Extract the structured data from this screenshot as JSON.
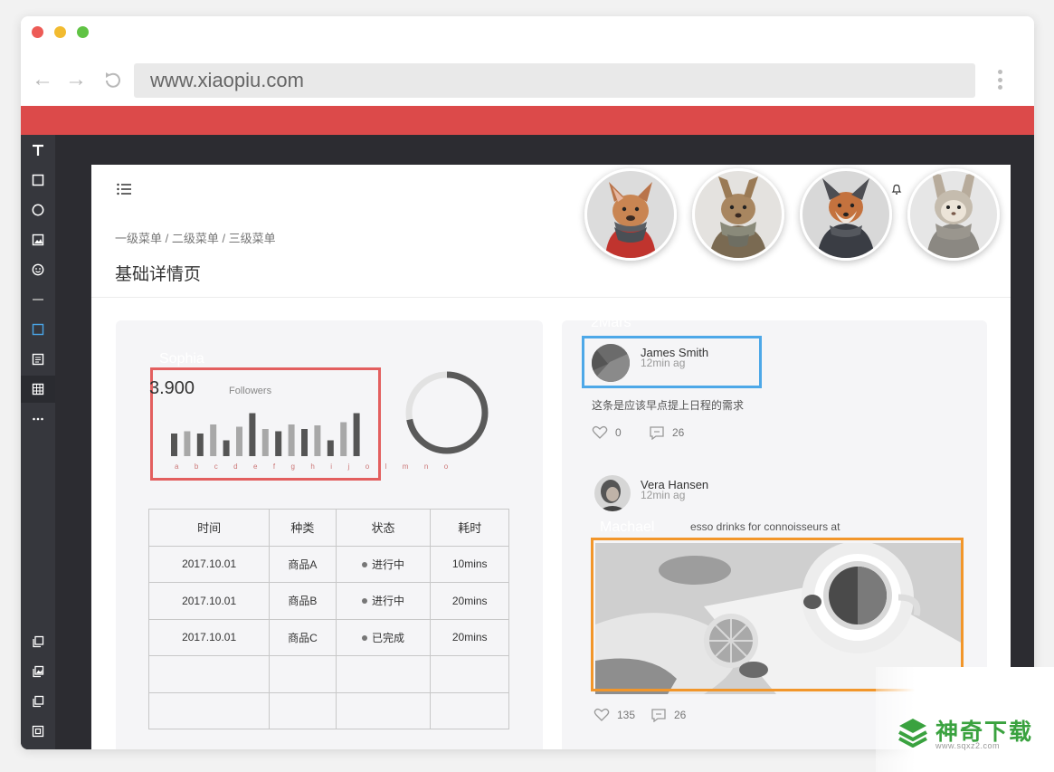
{
  "browser": {
    "url": "www.xiaopiu.com",
    "traffic_lights": [
      "#ed5b56",
      "#f2bb30",
      "#60c344"
    ],
    "accent": "#dc4a4a"
  },
  "toolbar": {
    "tools": [
      "text-tool-icon",
      "rectangle-tool-icon",
      "circle-tool-icon",
      "image-tool-icon",
      "emoji-tool-icon",
      "line-tool-icon",
      "panel-tool-icon",
      "form-tool-icon",
      "table-tool-icon",
      "more-tool-icon"
    ],
    "bottom_tools": [
      "copy-icon",
      "image-copy-icon",
      "duplicate-icon",
      "export-icon"
    ]
  },
  "page": {
    "breadcrumb": "一级菜单 / 二级菜单 / 三级菜单",
    "title": "基础详情页"
  },
  "stats_card": {
    "tag": "Sophia",
    "tag_color": "#e35f5f",
    "value": "3.900",
    "label": "Followers",
    "bar_values": [
      0.5,
      0.55,
      0.5,
      0.7,
      0.35,
      0.65,
      0.95,
      0.6,
      0.55,
      0.7,
      0.6,
      0.68,
      0.35,
      0.75,
      0.95
    ],
    "bar_axis": "a b c d e f g h i j o l m n o",
    "donut_progress": 0.72
  },
  "table": {
    "headers": [
      "时间",
      "种类",
      "状态",
      "耗时"
    ],
    "rows": [
      {
        "time": "2017.10.01",
        "type": "商品A",
        "status": "进行中",
        "duration": "10mins"
      },
      {
        "time": "2017.10.01",
        "type": "商品B",
        "status": "进行中",
        "duration": "20mins"
      },
      {
        "time": "2017.10.01",
        "type": "商品C",
        "status": "已完成",
        "duration": "20mins"
      }
    ],
    "empty_rows": 2
  },
  "feed": {
    "tag1": "2Mars",
    "tag1_color": "#4da8e8",
    "tag2": "Machael",
    "tag2_color": "#f2962a",
    "post1": {
      "name": "James Smith",
      "time": "12min ag",
      "text": "这条是应该早点提上日程的需求",
      "likes": "0",
      "comments": "26"
    },
    "post2": {
      "name": "Vera Hansen",
      "time": "12min ag",
      "text": "esso drinks for connoisseurs at",
      "likes": "135",
      "comments": "26"
    }
  },
  "watermark": {
    "title": "神奇下载",
    "url": "www.sqxz2.com"
  }
}
